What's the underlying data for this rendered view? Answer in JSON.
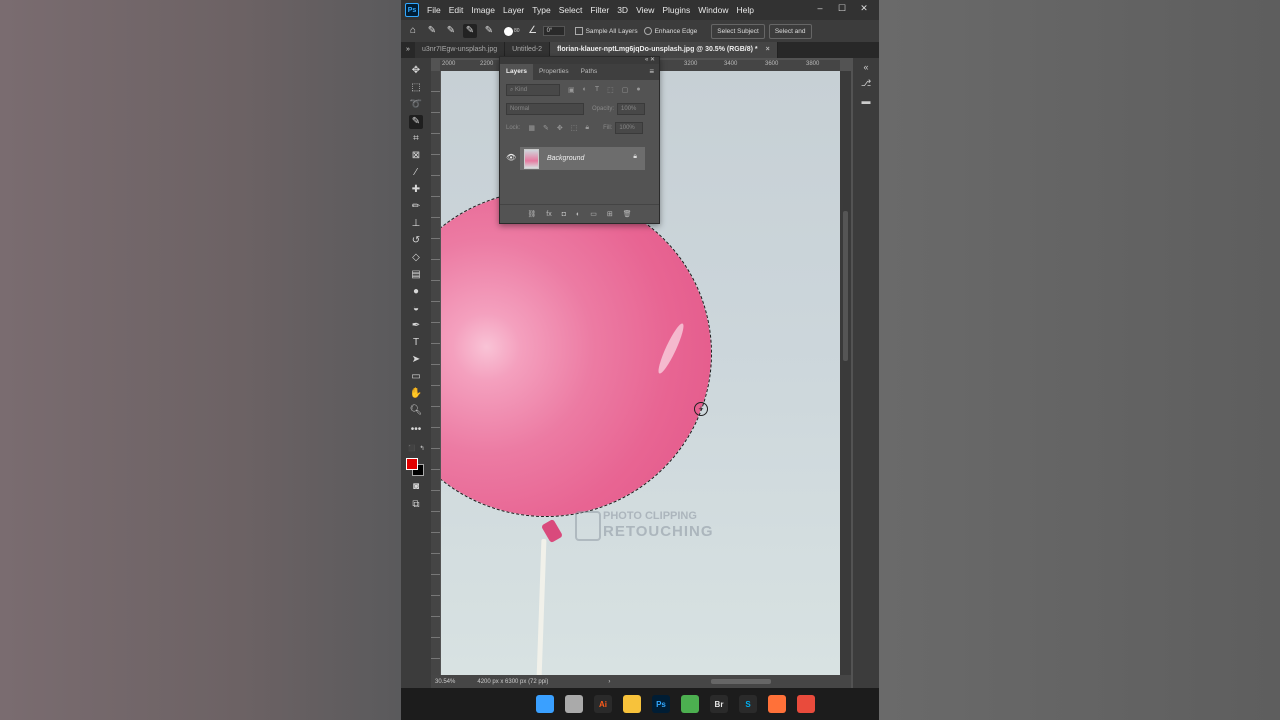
{
  "app": {
    "logo_text": "Ps",
    "menu": [
      "File",
      "Edit",
      "Image",
      "Layer",
      "Type",
      "Select",
      "Filter",
      "3D",
      "View",
      "Plugins",
      "Window",
      "Help"
    ],
    "window_controls": [
      "–",
      "☐",
      "✕"
    ]
  },
  "options_bar": {
    "brush_size": "80",
    "angle": "0°",
    "sample_all_layers": "Sample All Layers",
    "enhance_edge": "Enhance Edge",
    "select_subject": "Select Subject",
    "select_and_mask": "Select and"
  },
  "tabs": [
    {
      "label": "u3nr7IEgw-unsplash.jpg",
      "active": false
    },
    {
      "label": "Untitled-2",
      "active": false
    },
    {
      "label": "florian-klauer-nptLmg6jqDo-unsplash.jpg @ 30.5% (RGB/8) *",
      "active": true
    }
  ],
  "ruler": {
    "ticks": [
      "2000",
      "2200",
      "3200",
      "3400",
      "3600",
      "3800"
    ]
  },
  "layers_panel": {
    "tabs": [
      "Layers",
      "Properties",
      "Paths"
    ],
    "kind_placeholder": "Kind",
    "blend_mode": "Normal",
    "opacity_label": "Opacity:",
    "opacity_value": "100%",
    "lock_label": "Lock:",
    "fill_label": "Fill:",
    "fill_value": "100%",
    "layer_name": "Background",
    "bottom_icons": [
      "⛓",
      "fx",
      "◘",
      "◐",
      "▭",
      "⊞",
      "🗑"
    ]
  },
  "watermark": {
    "line1": "PHOTO CLIPPING",
    "line2": "RETOUCHING"
  },
  "status": {
    "zoom": "30.54%",
    "doc_info": "4200 px x 6300 px (72 ppi)",
    "arrow": "›"
  },
  "colors": {
    "foreground": "#e10000",
    "background": "#000000",
    "balloon": "#e86593"
  },
  "taskbar": [
    {
      "name": "windows-start-icon",
      "label": "",
      "color": "#3aa0ff"
    },
    {
      "name": "task-view-icon",
      "label": "",
      "color": "#aaaaaa"
    },
    {
      "name": "illustrator-icon",
      "label": "Ai",
      "color": "#ff5c1a"
    },
    {
      "name": "file-explorer-icon",
      "label": "",
      "color": "#f7c23b"
    },
    {
      "name": "photoshop-icon",
      "label": "Ps",
      "color": "#31a8ff"
    },
    {
      "name": "chrome-icon",
      "label": "",
      "color": "#4caf50"
    },
    {
      "name": "bridge-icon",
      "label": "Br",
      "color": "#e8e8e8"
    },
    {
      "name": "skype-icon",
      "label": "S",
      "color": "#00aff0"
    },
    {
      "name": "firefox-icon",
      "label": "",
      "color": "#ff7139"
    },
    {
      "name": "app-icon",
      "label": "",
      "color": "#e94b3c"
    }
  ]
}
